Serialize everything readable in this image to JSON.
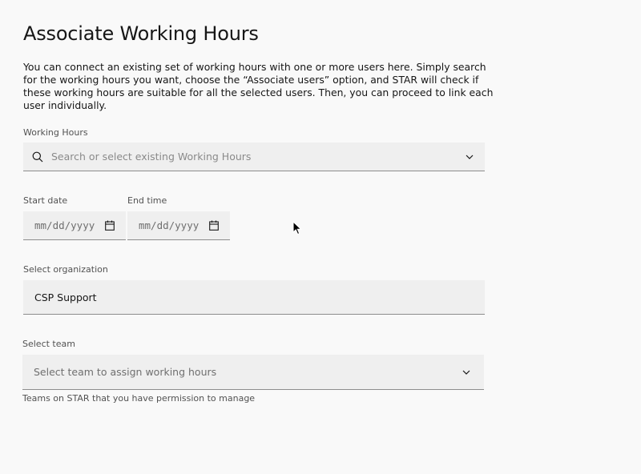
{
  "page": {
    "title": "Associate Working Hours",
    "description": "You can connect an existing set of working hours with one or more users here. Simply search for the working hours you want, choose the “Associate users” option, and STAR will check if these working hours are suitable for all the selected users. Then, you can proceed to link each user individually."
  },
  "working_hours": {
    "label": "Working Hours",
    "placeholder": "Search or select existing Working Hours",
    "search_icon": "search-icon",
    "dropdown_icon": "chevron-down-icon"
  },
  "start_date": {
    "label": "Start date",
    "placeholder": "mm/dd/yyyy",
    "icon": "calendar-icon"
  },
  "end_time": {
    "label": "End time",
    "placeholder": "mm/dd/yyyy",
    "icon": "calendar-icon"
  },
  "organization": {
    "label": "Select organization",
    "value": "CSP Support"
  },
  "team": {
    "label": "Select team",
    "placeholder": "Select team to assign working hours",
    "helper": "Teams on STAR that you have permission to manage",
    "dropdown_icon": "chevron-down-icon"
  },
  "colors": {
    "background": "#f9f9f9",
    "field_background": "#efefef",
    "text_primary": "#161616",
    "text_secondary": "#525252",
    "placeholder": "#8a8a8a",
    "field_border": "#8d8d8d"
  }
}
